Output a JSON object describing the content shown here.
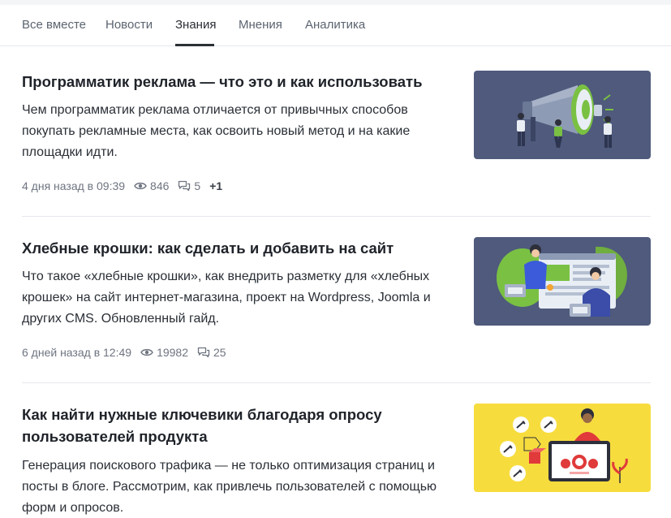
{
  "tabs": [
    {
      "label": "Все вместе",
      "active": false
    },
    {
      "label": "Новости",
      "active": false
    },
    {
      "label": "Знания",
      "active": true
    },
    {
      "label": "Мнения",
      "active": false
    },
    {
      "label": "Аналитика",
      "active": false
    }
  ],
  "articles": [
    {
      "title": "Программатик реклама — что это и как использовать",
      "description": "Чем программатик реклама отличается от привычных способов покупать рекламные места, как освоить новый метод и на какие площадки идти.",
      "date": "4 дня назад в 09:39",
      "views": "846",
      "comments": "5",
      "reactions": "+1",
      "thumb_bg": "#4f5a7c"
    },
    {
      "title": "Хлебные крошки: как сделать и добавить на сайт",
      "description": "Что такое «хлебные крошки», как внедрить разметку для «хлебных крошек» на сайт интернет-магазина, проект на Wordpress, Joomla и других CMS. Обновленный гайд.",
      "date": "6 дней назад в 12:49",
      "views": "19982",
      "comments": "25",
      "thumb_bg": "#4f5a7c"
    },
    {
      "title": "Как найти нужные ключевики благодаря опросу пользователей продукта",
      "description": "Генерация поискового трафика — не только оптимизация страниц и посты в блоге. Рассмотрим, как привлечь пользователей с помощью форм и опросов.",
      "thumb_bg": "#f7dc3e"
    }
  ],
  "icons": {
    "views": "eye-icon",
    "comments": "comments-icon"
  },
  "colors": {
    "text": "#1f2329",
    "muted": "#6e7480",
    "divider": "#e6e8ec",
    "accent_green": "#7ac143",
    "thumb_dark": "#4f5a7c",
    "thumb_yellow": "#f7dc3e"
  }
}
